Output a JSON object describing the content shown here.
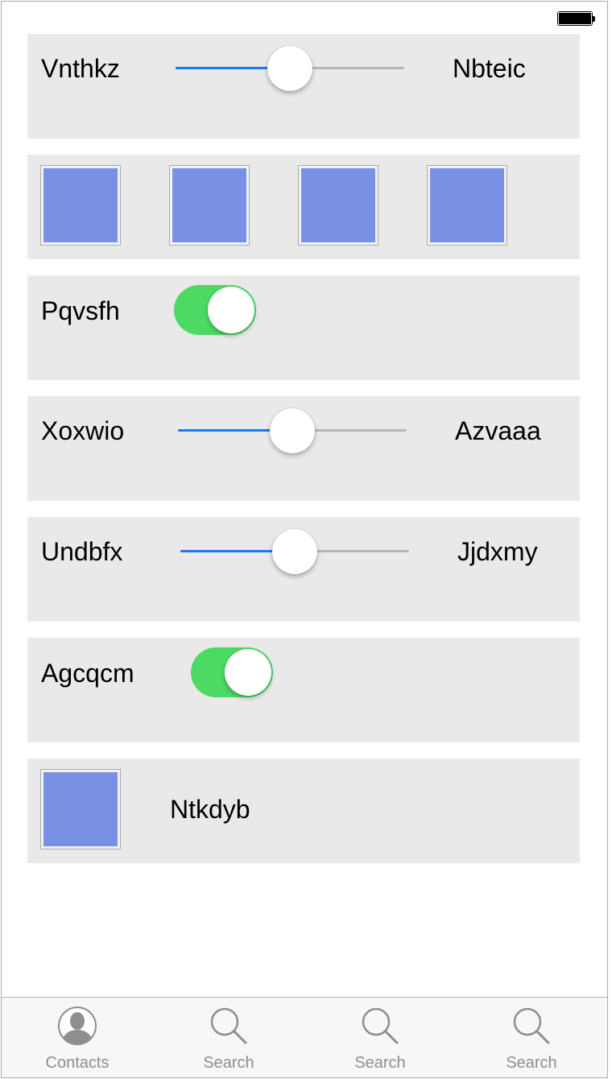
{
  "status_bar": {
    "battery_icon": "battery-icon"
  },
  "rows": {
    "r1": {
      "left_label": "Vnthkz",
      "right_label": "Nbteic",
      "slider_value": 0.5
    },
    "r2": {
      "images": [
        "image-placeholder",
        "image-placeholder",
        "image-placeholder",
        "image-placeholder"
      ]
    },
    "r3": {
      "label": "Pqvsfh",
      "toggle_on": true
    },
    "r4": {
      "left_label": "Xoxwio",
      "right_label": "Azvaaa",
      "slider_value": 0.5
    },
    "r5": {
      "left_label": "Undbfx",
      "right_label": "Jjdxmy",
      "slider_value": 0.5
    },
    "r6": {
      "label": "Agcqcm",
      "toggle_on": true
    },
    "r7": {
      "label": "Ntkdyb",
      "image": "image-placeholder"
    }
  },
  "tabbar": {
    "tabs": [
      {
        "label": "Contacts",
        "icon": "contacts-icon"
      },
      {
        "label": "Search",
        "icon": "search-icon"
      },
      {
        "label": "Search",
        "icon": "search-icon"
      },
      {
        "label": "Search",
        "icon": "search-icon"
      }
    ]
  },
  "colors": {
    "accent": "#1a7bec",
    "toggle_on": "#4cd964",
    "row_background": "#e9e9e9",
    "image_fill": "#7991e4",
    "tab_inactive": "#8e8e8e"
  }
}
